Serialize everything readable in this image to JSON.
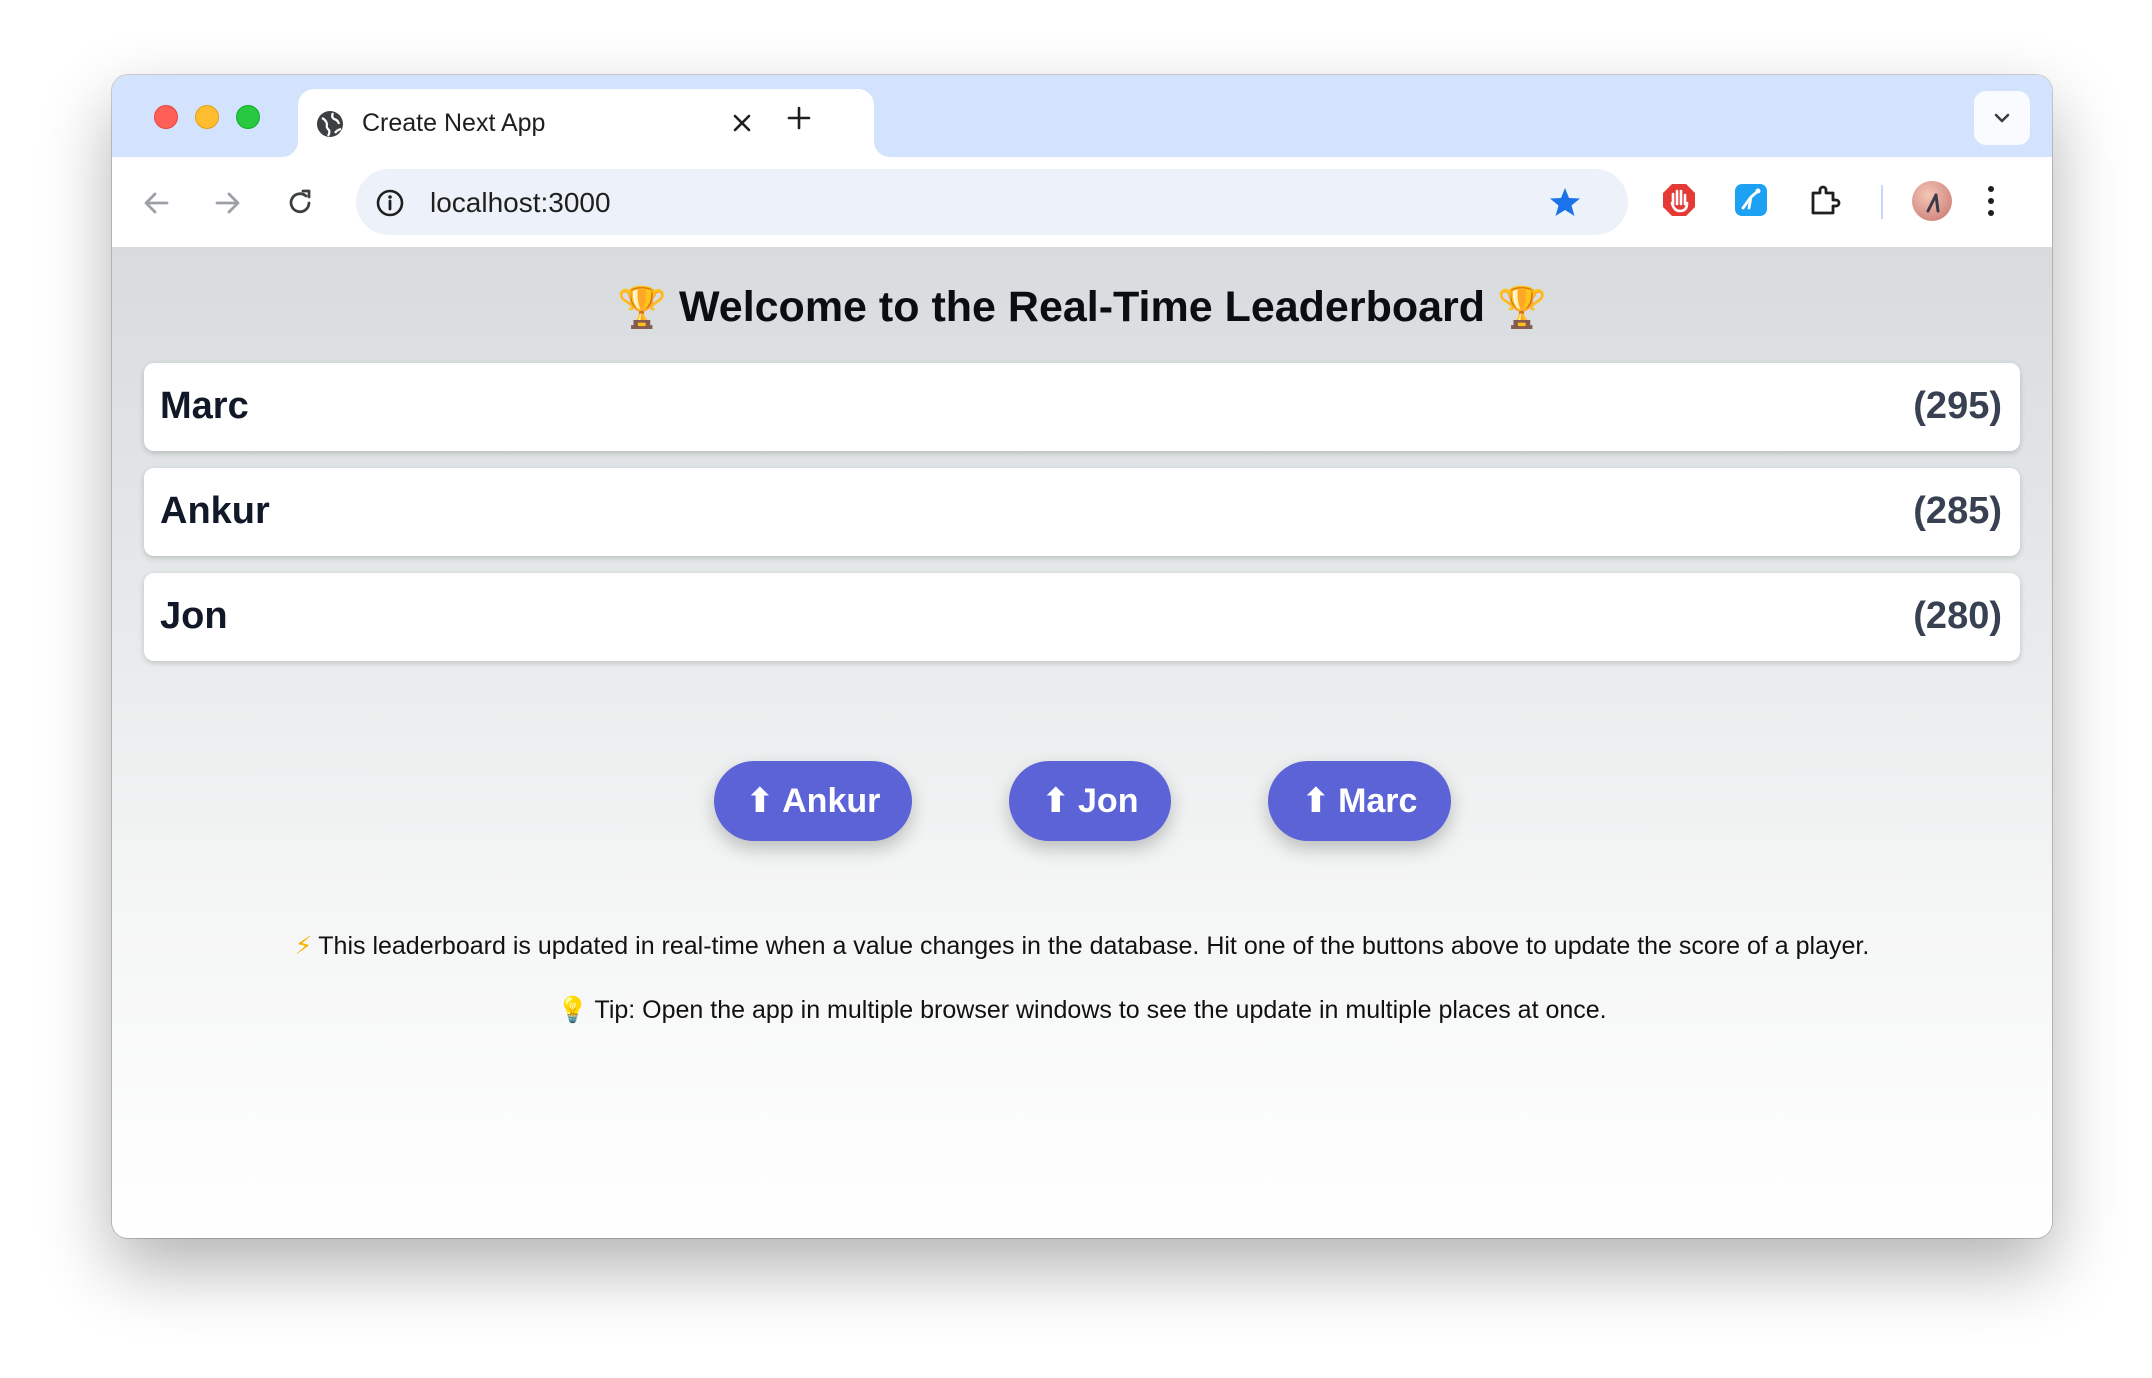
{
  "browser": {
    "tab_title": "Create Next App",
    "url": "localhost:3000"
  },
  "page": {
    "heading_icon": "🏆",
    "heading_text": "Welcome to the Real-Time Leaderboard",
    "leaderboard": [
      {
        "name": "Marc",
        "score": "(295)"
      },
      {
        "name": "Ankur",
        "score": "(285)"
      },
      {
        "name": "Jon",
        "score": "(280)"
      }
    ],
    "buttons": [
      {
        "arrow": "⬆",
        "label": "Ankur"
      },
      {
        "arrow": "⬆",
        "label": "Jon"
      },
      {
        "arrow": "⬆",
        "label": "Marc"
      }
    ],
    "note_icon": "⚡",
    "note_text": "This leaderboard is updated in real-time when a value changes in the database. Hit one of the buttons above to update the score of a player.",
    "tip_icon": "💡",
    "tip_text": "Tip: Open the app in multiple browser windows to see the update in multiple places at once."
  },
  "colors": {
    "tabstrip_bg": "#d3e3fd",
    "button_bg": "#5b63d6",
    "star_blue": "#1a73e8"
  }
}
